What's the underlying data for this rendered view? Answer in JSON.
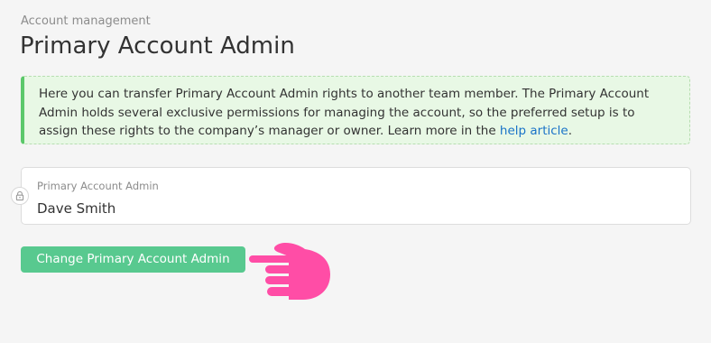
{
  "header": {
    "breadcrumb": "Account management",
    "title": "Primary Account Admin"
  },
  "info": {
    "text_before_link": "Here you can transfer Primary Account Admin rights to another team member. The Primary Account Admin holds several exclusive permissions for managing the account, so the preferred setup is to assign these rights to the company’s manager or owner. Learn more in the ",
    "link_text": "help article",
    "text_after_link": "."
  },
  "admin_field": {
    "label": "Primary Account Admin",
    "value": "Dave Smith",
    "icon": "lock-icon"
  },
  "actions": {
    "change_button_label": "Change Primary Account Admin"
  },
  "decoration": {
    "pointer_icon": "pointing-hand-icon"
  },
  "colors": {
    "background": "#f5f5f5",
    "info_background": "#e8f8e5",
    "info_accent": "#5bc86a",
    "link": "#1a73c8",
    "button": "#58c98f",
    "pointer": "#ff4da6"
  }
}
